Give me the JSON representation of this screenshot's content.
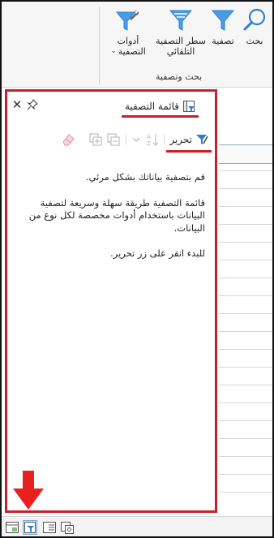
{
  "ribbon": {
    "buttons": {
      "search": "بحث",
      "filter": "تصفية",
      "auto_filter_line_1": "سطر التصفية",
      "auto_filter_line_2": "التلقائي",
      "filter_tools_line_1": "أدوات",
      "filter_tools_line_2": "التصفية"
    },
    "group_label": "بحث وتصفية"
  },
  "pane": {
    "title": "قائمة التصفية",
    "edit_label": "تحرير",
    "paragraphs": [
      "قم بتصفية بياناتك بشكل مرئي.",
      "قائمة التصفية طريقة سهلة وسريعة لتصفية البيانات باستخدام أدوات مخصصة لكل نوع من البيانات.",
      "للبدء انقر على زر تحرير."
    ]
  },
  "colors": {
    "highlight": "#c8202a",
    "filter_blue": "#2e7fd1"
  }
}
